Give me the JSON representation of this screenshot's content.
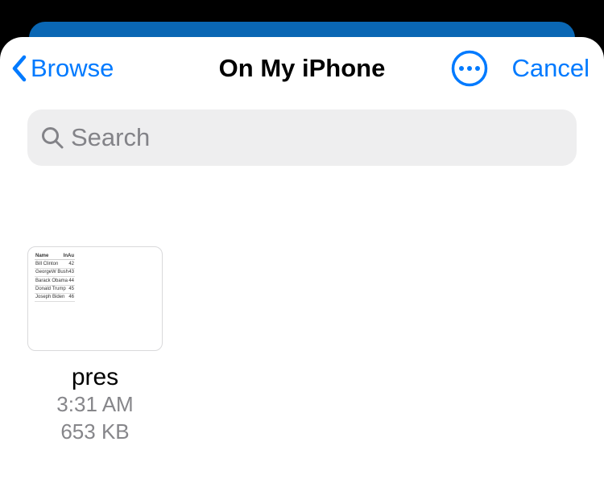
{
  "nav": {
    "back_label": "Browse",
    "title": "On My iPhone",
    "cancel_label": "Cancel"
  },
  "search": {
    "placeholder": "Search"
  },
  "files": [
    {
      "name": "pres",
      "time": "3:31 AM",
      "size": "653 KB",
      "thumb": {
        "header": [
          "Name",
          "InAu"
        ],
        "rows": [
          [
            "Bill Clinton",
            "42"
          ],
          [
            "GeorgeW Bush",
            "43"
          ],
          [
            "Barack Obama",
            "44"
          ],
          [
            "Donald Trump",
            "45"
          ],
          [
            "Joseph Biden",
            "46"
          ]
        ]
      }
    }
  ]
}
